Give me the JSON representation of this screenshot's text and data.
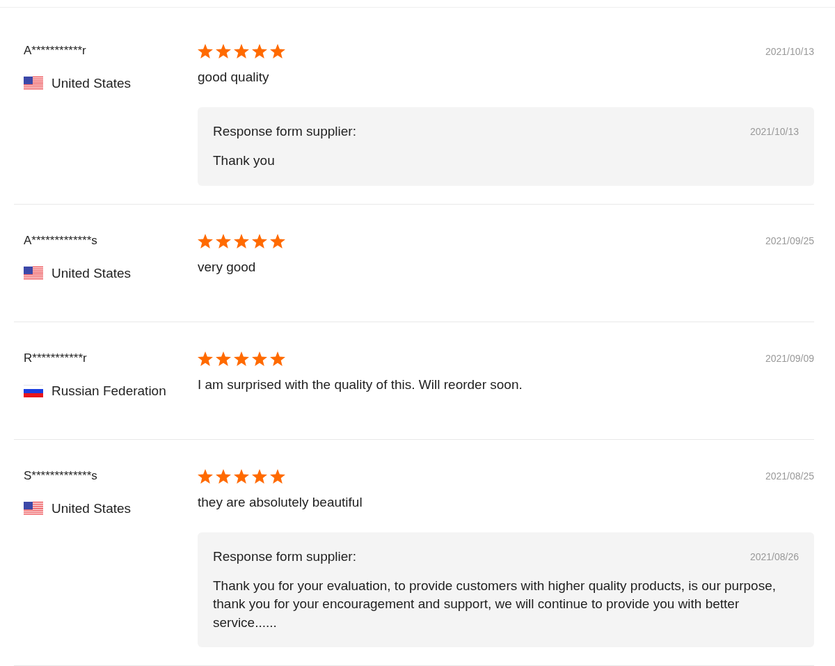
{
  "reviews": [
    {
      "name": "A***********r",
      "kind": "us",
      "country": "United States",
      "stars": 5,
      "date": "2021/10/13",
      "text": "good quality",
      "reply": {
        "heading": "Response form supplier:",
        "date": "2021/10/13",
        "text": "Thank you"
      }
    },
    {
      "name": "A*************s",
      "kind": "us",
      "country": "United States",
      "stars": 5,
      "date": "2021/09/25",
      "text": "very good"
    },
    {
      "name": "R***********r",
      "kind": "ru",
      "country": "Russian Federation",
      "stars": 5,
      "date": "2021/09/09",
      "text": "I am surprised with the quality of this. Will reorder soon."
    },
    {
      "name": "S*************s",
      "kind": "us",
      "country": "United States",
      "stars": 5,
      "date": "2021/08/25",
      "text": "they are absolutely beautiful",
      "reply": {
        "heading": "Response form supplier:",
        "date": "2021/08/26",
        "text": "Thank you for your evaluation, to provide customers with higher quality products, is our purpose, thank you for your encouragement and support, we will continue to provide you with better service......"
      }
    }
  ]
}
